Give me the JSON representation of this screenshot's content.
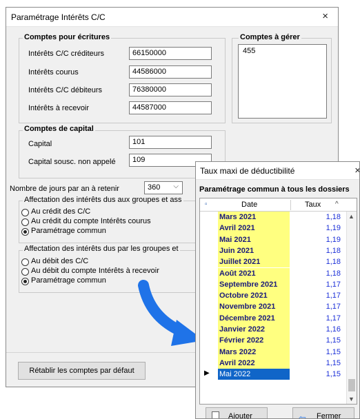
{
  "dialog1": {
    "title": "Paramétrage Intérêts C/C",
    "close": "×",
    "comptes_ecritures": {
      "title": "Comptes pour écritures",
      "fields": [
        {
          "label": "Intérêts C/C créditeurs",
          "value": "66150000"
        },
        {
          "label": "Intérêts courus",
          "value": "44586000"
        },
        {
          "label": "Intérêts C/C débiteurs",
          "value": "76380000"
        },
        {
          "label": "Intérêts à recevoir",
          "value": "44587000"
        }
      ]
    },
    "comptes_gerer": {
      "title": "Comptes à gérer",
      "items": [
        "455"
      ]
    },
    "comptes_capital": {
      "title": "Comptes de capital",
      "fields": [
        {
          "label": "Capital",
          "value": "101"
        },
        {
          "label": "Capital sousc. non appelé",
          "value": "109"
        }
      ]
    },
    "nb_jours": {
      "label": "Nombre de jours par an à retenir",
      "value": "360",
      "arrow": "⌵"
    },
    "affectation_aux": {
      "title": "Affectation des intérêts dus aux groupes et ass",
      "options": [
        "Au crédit des C/C",
        "Au crédit du compte Intérêts courus",
        "Paramétrage commun"
      ],
      "selected": 2
    },
    "affectation_par": {
      "title": "Affectation des intérêts dus par les groupes et",
      "options": [
        "Au débit des C/C",
        "Au débit du compte Intérêts à recevoir",
        "Paramétrage commun"
      ],
      "selected": 2
    },
    "reset_button": "Rétablir les comptes par défaut"
  },
  "dialog2": {
    "title": "Taux maxi de déductibilité",
    "close": "×",
    "subtitle": "Paramétrage commun à tous les dossiers",
    "columns": {
      "date": "Date",
      "taux": "Taux"
    },
    "rows": [
      {
        "date": "Mars 2021",
        "taux": "1,18"
      },
      {
        "date": "Avril 2021",
        "taux": "1,19"
      },
      {
        "date": "Mai 2021",
        "taux": "1,19"
      },
      {
        "date": "Juin 2021",
        "taux": "1,18"
      },
      {
        "date": "Juillet 2021",
        "taux": "1,18"
      },
      {
        "date": "Août 2021",
        "taux": "1,18"
      },
      {
        "date": "Septembre 2021",
        "taux": "1,17"
      },
      {
        "date": "Octobre 2021",
        "taux": "1,17"
      },
      {
        "date": "Novembre 2021",
        "taux": "1,17"
      },
      {
        "date": "Décembre 2021",
        "taux": "1,17"
      },
      {
        "date": "Janvier 2022",
        "taux": "1,16"
      },
      {
        "date": "Février 2022",
        "taux": "1,15"
      },
      {
        "date": "Mars 2022",
        "taux": "1,15"
      },
      {
        "date": "Avril 2022",
        "taux": "1,15"
      },
      {
        "date": "Mai 2022",
        "taux": "1,15"
      }
    ],
    "selected_row": 14,
    "current_marker": "▶",
    "ajouter_button": "Ajouter",
    "fermer_button": "Fermer"
  },
  "colors": {
    "arrow": "#1f73e8",
    "date_cell_bg": "#ffff80",
    "taux_text": "#1b2fd8",
    "selection": "#1065c8"
  },
  "icons": {
    "arrow": "blue-curved-arrow-icon",
    "ajouter": "new-document-icon",
    "fermer": "close-exit-icon"
  }
}
